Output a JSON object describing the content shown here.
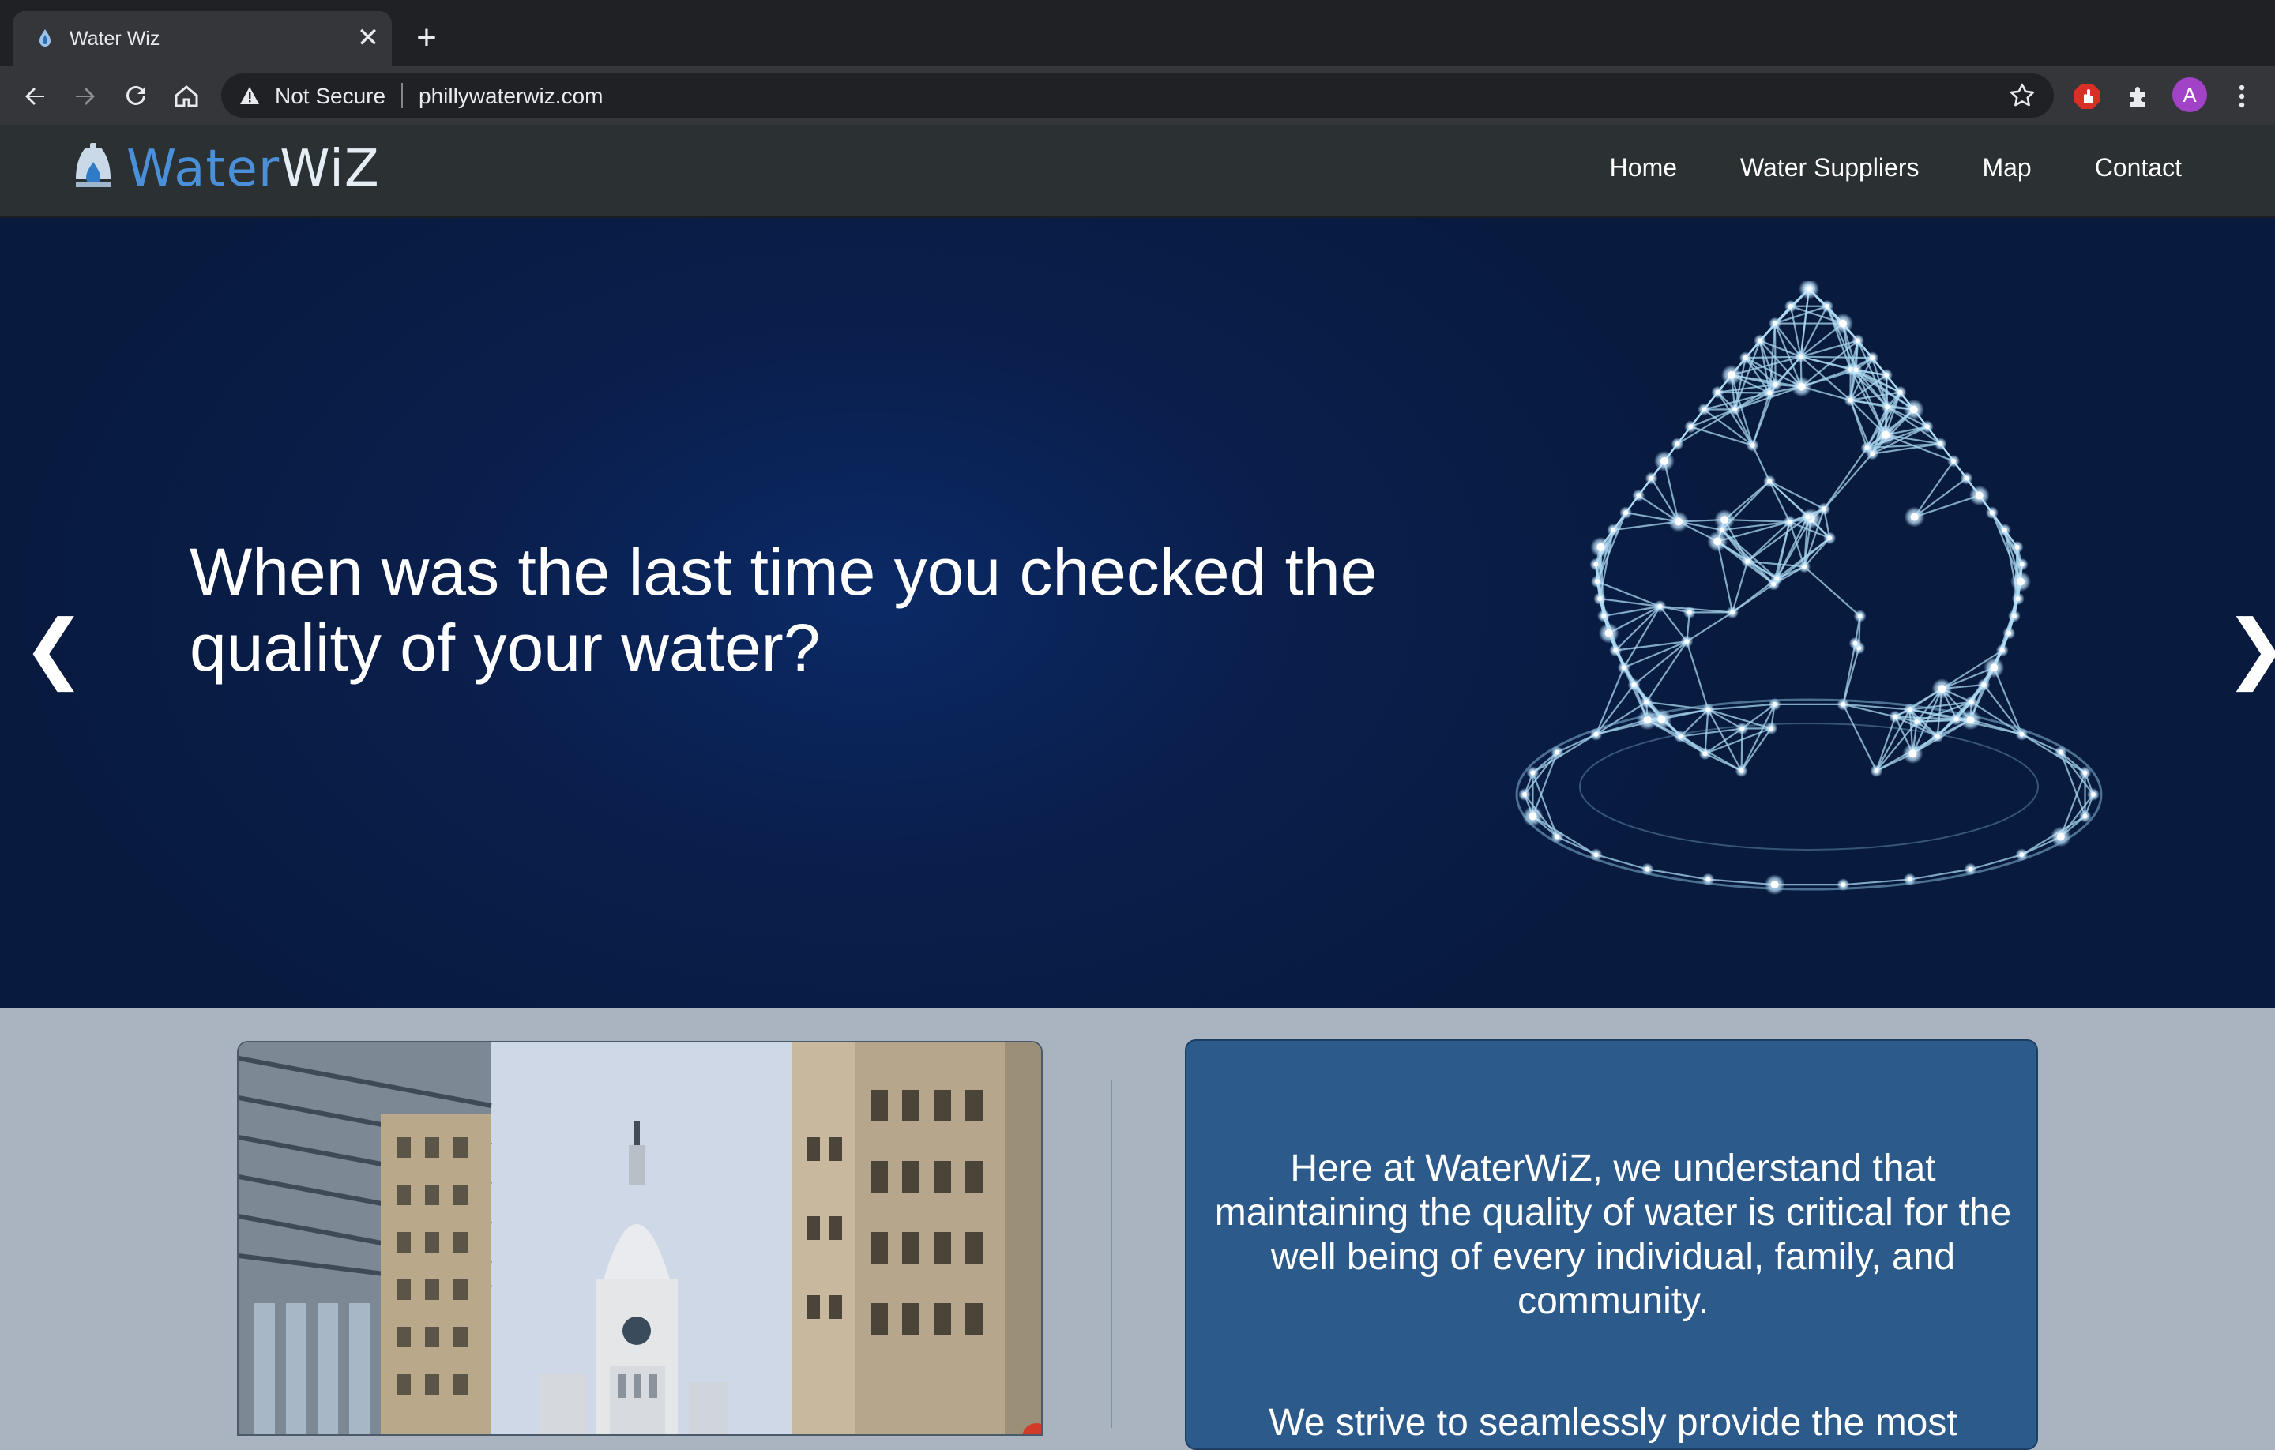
{
  "browser": {
    "tab_title": "Water Wiz",
    "tab_close": "✕",
    "new_tab": "+",
    "security_label": "Not Secure",
    "url": "phillywaterwiz.com",
    "profile_initial": "A"
  },
  "site": {
    "logo_water": "Water",
    "logo_wiz": "WiZ",
    "nav": [
      "Home",
      "Water Suppliers",
      "Map",
      "Contact"
    ]
  },
  "hero": {
    "headline": "When was the last time you checked the quality of your water?",
    "prev_arrow": "❮",
    "next_arrow": "❯"
  },
  "about": {
    "paragraph1": "Here at WaterWiZ, we understand that maintaining the quality of water is critical for the well being of every individual, family, and community.",
    "paragraph2": "We strive to seamlessly provide the most"
  },
  "colors": {
    "hero_bg": "#0a1f4d",
    "nav_bg": "#2b3033",
    "about_box": "#2c5a8a",
    "logo_blue": "#4a90d9"
  }
}
